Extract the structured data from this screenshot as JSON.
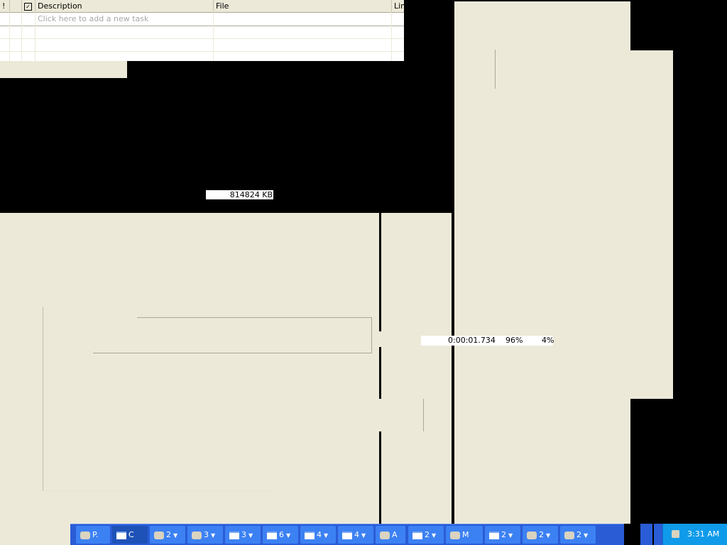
{
  "task_list": {
    "columns": [
      "!",
      "",
      "Description",
      "File",
      "Lin"
    ],
    "new_task_placeholder": "Click here to add a new task"
  },
  "memory_readout": "814824 KB",
  "timing": {
    "elapsed": "0:00:01.734",
    "percent_a": "96%",
    "percent_b": "4%"
  },
  "taskbar": {
    "buttons": [
      {
        "icon": "app-icon",
        "label": "P."
      },
      {
        "icon": "window-icon",
        "label": "C"
      },
      {
        "icon": "paint-icon",
        "label": "2"
      },
      {
        "icon": "tools-icon",
        "label": "3"
      },
      {
        "icon": "window-icon",
        "label": "3"
      },
      {
        "icon": "window-icon",
        "label": "6"
      },
      {
        "icon": "window-icon",
        "label": "4"
      },
      {
        "icon": "window-icon",
        "label": "4"
      },
      {
        "icon": "pen-icon",
        "label": "A"
      },
      {
        "icon": "window-icon",
        "label": "2"
      },
      {
        "icon": "monitor-icon",
        "label": "M"
      },
      {
        "icon": "window-icon",
        "label": "2"
      },
      {
        "icon": "computer-icon",
        "label": "2"
      },
      {
        "icon": "network-icon",
        "label": "2"
      }
    ]
  },
  "tray": {
    "clock": "3:31 AM"
  },
  "colors": {
    "window_bg": "#ECE9D8",
    "taskbar": "#2A5CD6",
    "tray": "#0F9BEA"
  }
}
